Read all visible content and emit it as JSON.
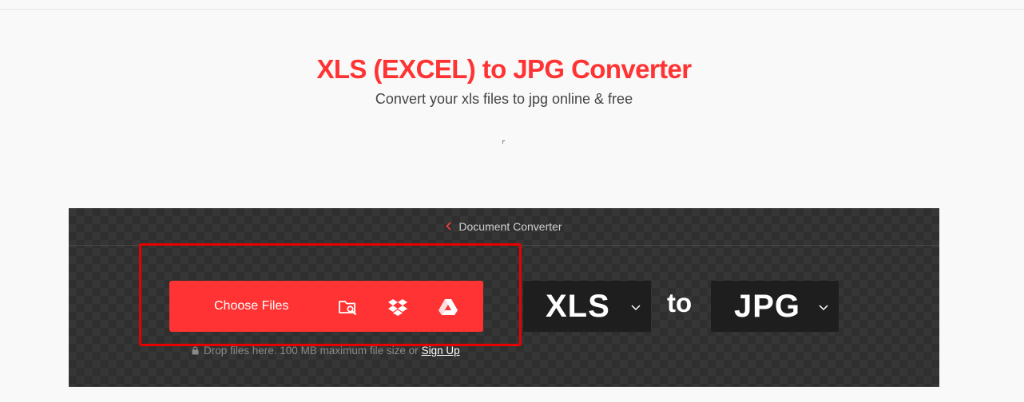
{
  "header": {
    "title": "XLS (EXCEL) to JPG Converter",
    "subtitle": "Convert your xls files to jpg online & free"
  },
  "converter": {
    "breadcrumb": "Document Converter",
    "choose_files_label": "Choose Files",
    "sources": [
      "folder-search-icon",
      "dropbox-icon",
      "google-drive-icon"
    ],
    "drop_hint": "Drop files here. 100 MB maximum file size or",
    "signup_label": "Sign Up",
    "source_format": "XLS",
    "to_label": "to",
    "target_format": "JPG"
  },
  "colors": {
    "brand_red": "#ff3333",
    "panel_bg": "#363636",
    "select_bg": "#1e1e1e",
    "highlight": "#e80000"
  }
}
